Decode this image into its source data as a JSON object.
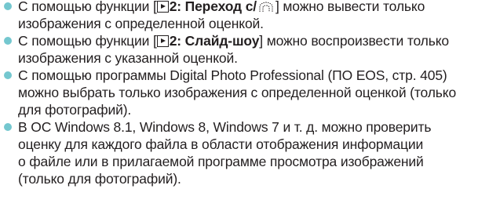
{
  "notes": [
    {
      "before": "С помощью функции [",
      "bold": "2: Переход с/",
      "after": "] можно вывести только",
      "rest": [
        "изображения с определенной оценкой."
      ],
      "icon": "rating-icon"
    },
    {
      "before": "С помощью функции [",
      "bold": "2: Слайд-шоу",
      "after": "] можно воспроизвести только",
      "rest": [
        "изображения с указанной оценкой."
      ]
    },
    {
      "lines": [
        "С помощью программы Digital Photo Professional (ПО EOS, стр. 405)",
        "можно выбрать только изображения с определенной оценкой (только",
        "для фотографий)."
      ]
    },
    {
      "lines": [
        "В ОС Windows 8.1, Windows 8, Windows 7 и т. д. можно проверить",
        "оценку для каждого файла в области отображения информации",
        "о файле или в прилагаемой программе просмотра изображений",
        "(только для фотографий)."
      ]
    }
  ],
  "colors": {
    "bullet": "#74c7cf",
    "text": "#231f20"
  },
  "icons": [
    "playback-icon",
    "rating-icon"
  ]
}
